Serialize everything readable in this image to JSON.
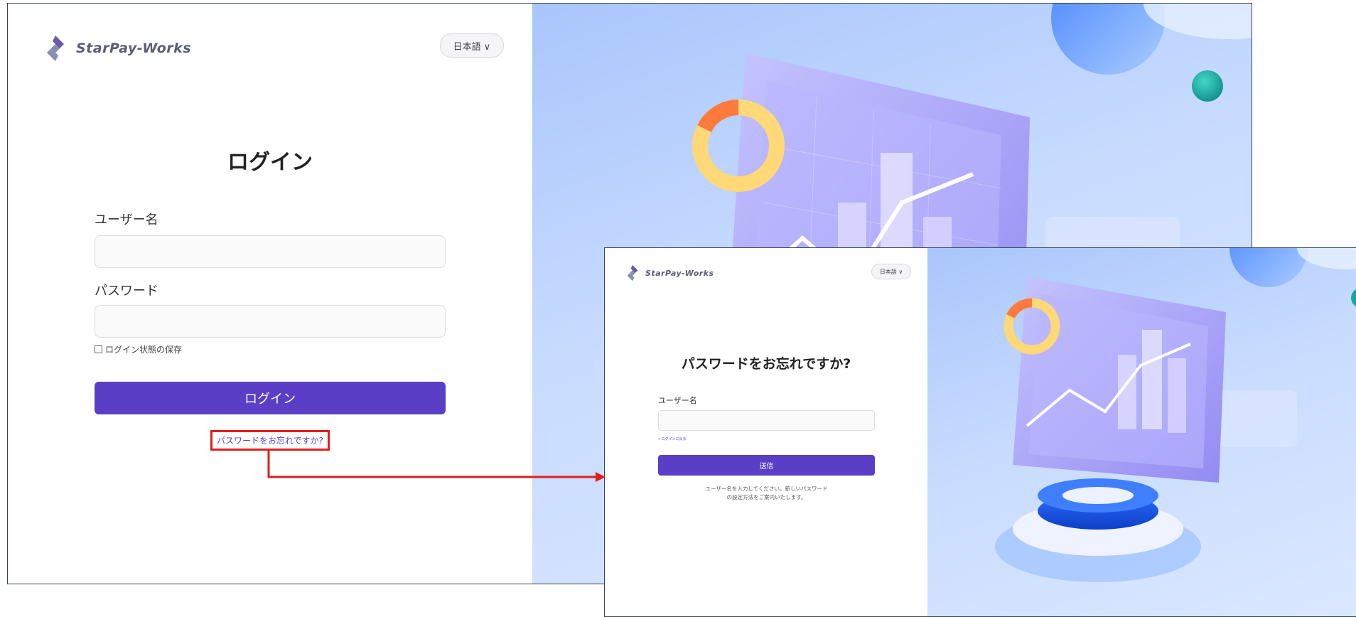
{
  "brand": {
    "name": "StarPay-Works"
  },
  "colors": {
    "primary": "#5a3fc6",
    "highlight": "#e21c1c",
    "frame_border": "#3a4452"
  },
  "login_screen": {
    "language": "日本語 ∨",
    "title": "ログイン",
    "username_label": "ユーザー名",
    "password_label": "パスワード",
    "remember_label": "ログイン状態の保存",
    "login_button": "ログイン",
    "forgot_link": "パスワードをお忘れですか?"
  },
  "forgot_screen": {
    "language": "日本語 ∨",
    "title": "パスワードをお忘れですか?",
    "username_label": "ユーザー名",
    "back_link": "« ログインに戻る",
    "submit_button": "送信",
    "help_text": "ユーザー名を入力してください。新しいパスワード\nの設定方法をご案内いたします。"
  },
  "icons": [
    "logo-mark-icon",
    "chevron-down-icon",
    "checkbox-icon",
    "arrow-connector-icon"
  ]
}
